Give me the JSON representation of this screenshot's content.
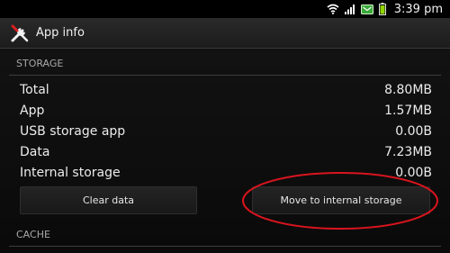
{
  "status_bar": {
    "time": "3:39 pm",
    "icons": [
      "wifi-icon",
      "signal-icon",
      "notification-icon",
      "battery-icon"
    ]
  },
  "action_bar": {
    "title": "App info",
    "icon": "tools-icon"
  },
  "storage": {
    "header": "STORAGE",
    "rows": [
      {
        "label": "Total",
        "value": "8.80MB"
      },
      {
        "label": "App",
        "value": "1.57MB"
      },
      {
        "label": "USB storage app",
        "value": "0.00B"
      },
      {
        "label": "Data",
        "value": "7.23MB"
      },
      {
        "label": "Internal storage",
        "value": "0.00B"
      }
    ],
    "clear_data_label": "Clear data",
    "move_label": "Move to internal storage"
  },
  "cache": {
    "header": "CACHE"
  },
  "colors": {
    "annotation": "#d9141e",
    "background": "#0b0b0b",
    "battery": "#8fd400"
  }
}
